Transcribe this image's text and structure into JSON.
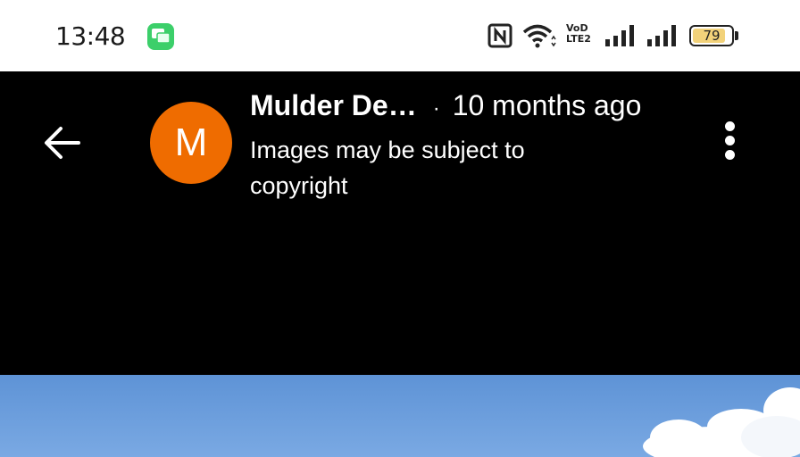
{
  "statusbar": {
    "time": "13:48",
    "volte_label_1": "VoD",
    "volte_label_2": "LTE2",
    "battery_level": "79",
    "icons": [
      "messages-app-icon",
      "nfc-icon",
      "wifi-icon",
      "volte-icon",
      "signal-icon",
      "signal-icon",
      "battery-icon"
    ]
  },
  "header": {
    "avatar_letter": "M",
    "author": "Mulder De…",
    "separator": "·",
    "time_ago": "10 months ago",
    "notice": "Images may be subject to copyright",
    "icons": [
      "back-arrow-icon",
      "more-vert-icon"
    ]
  },
  "colors": {
    "avatar": "#ef6c00",
    "appbar_bg": "#000000",
    "sky": "#6a9fe0"
  }
}
